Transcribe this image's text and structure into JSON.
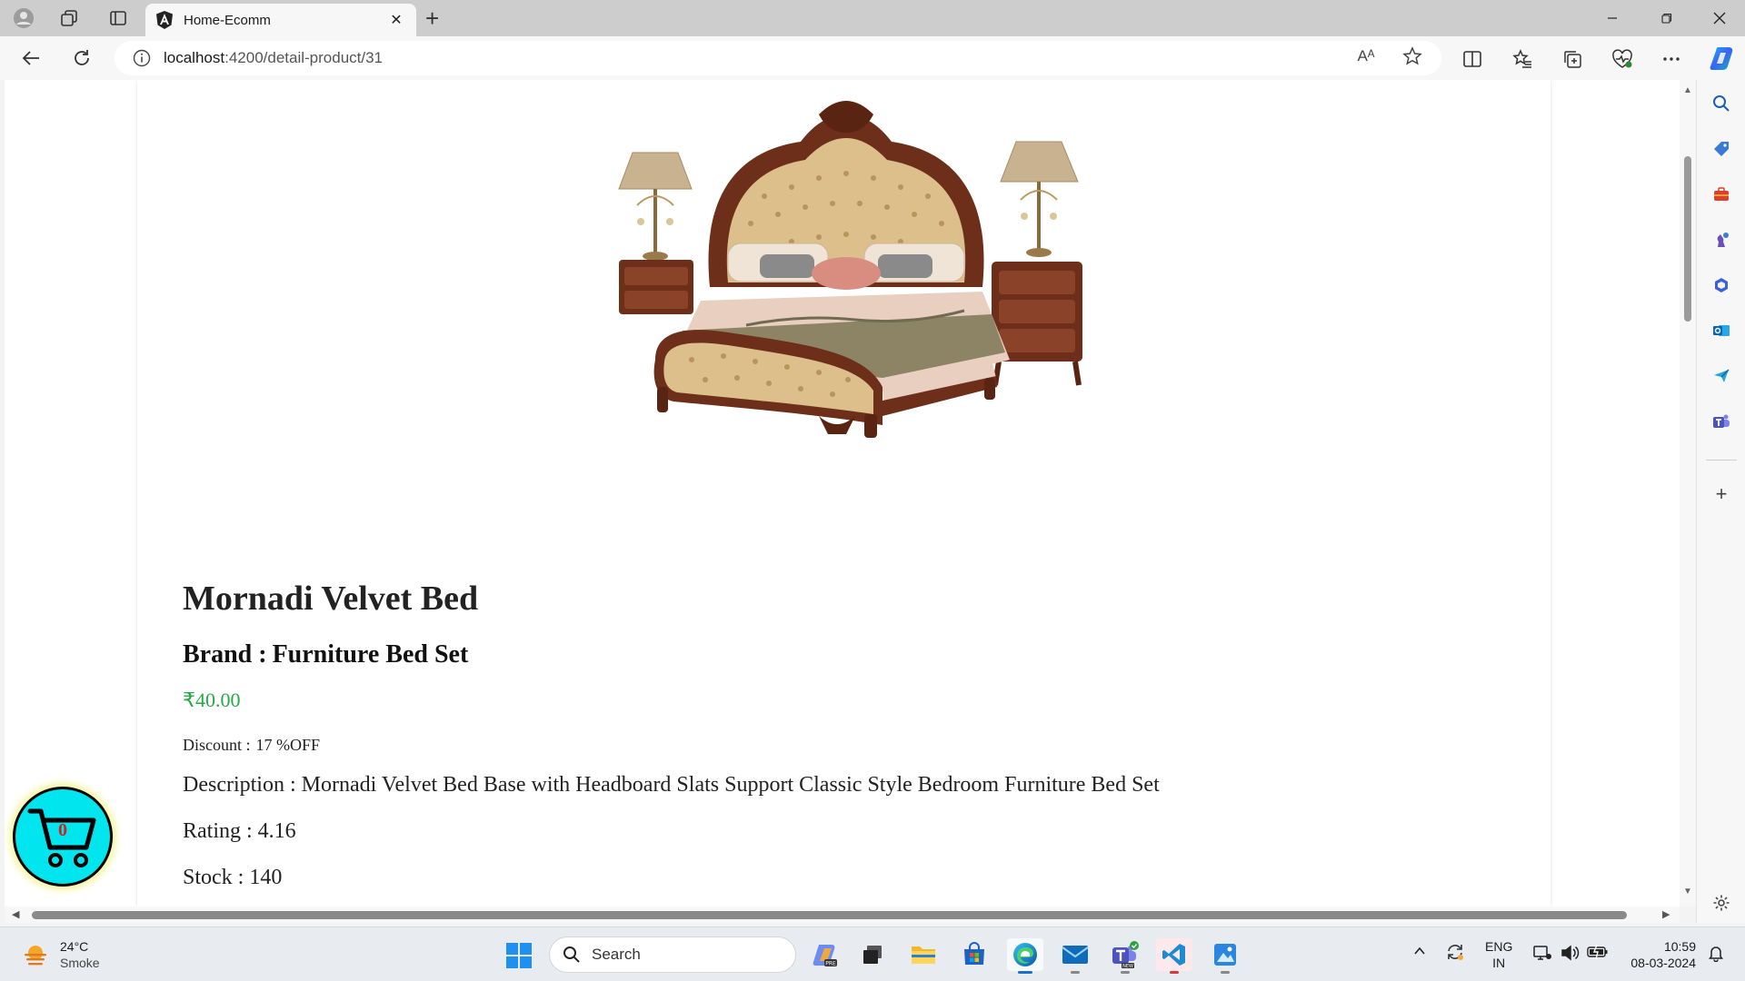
{
  "browser": {
    "tab_title": "Home-Ecomm",
    "url_host": "localhost",
    "url_path": ":4200/detail-product/31",
    "read_aloud_label": "Aᴬ"
  },
  "product": {
    "image_alt": "Mornadi Velvet Bed",
    "title": "Mornadi Velvet Bed",
    "brand_label": "Brand :",
    "brand": "Furniture Bed Set",
    "price": "₹40.00",
    "discount_label": "Discount :",
    "discount": "17 %OFF",
    "description_label": "Description :",
    "description": "Mornadi Velvet Bed Base with Headboard Slats Support Classic Style Bedroom Furniture Bed Set",
    "rating_label": "Rating :",
    "rating": "4.16",
    "stock_label": "Stock :",
    "stock": "140"
  },
  "cart": {
    "count": "0"
  },
  "taskbar": {
    "weather_temp": "24°C",
    "weather_desc": "Smoke",
    "search_placeholder": "Search",
    "lang_top": "ENG",
    "lang_bottom": "IN",
    "time": "10:59",
    "date": "08-03-2024"
  },
  "colors": {
    "price_green": "#28a745",
    "cart_cyan": "#00e5ee",
    "cart_count_red": "#cc2222"
  }
}
